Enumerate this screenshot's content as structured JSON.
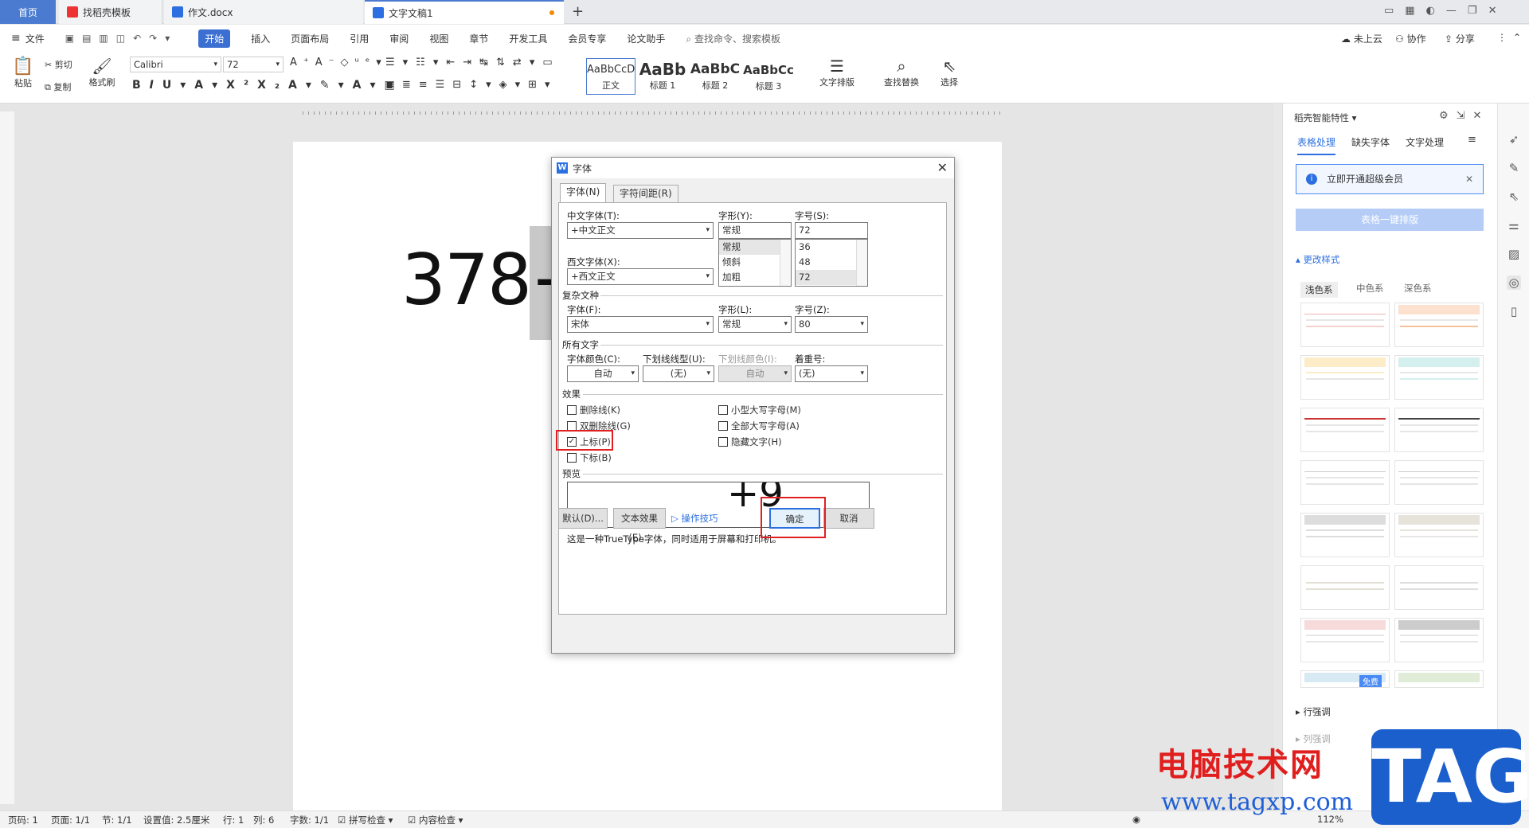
{
  "tabs": {
    "home": "首页",
    "template": "找稻壳模板",
    "doc1": "作文.docx",
    "doc2": "文字文稿1",
    "new_tab": "+"
  },
  "menu": {
    "file": "文件",
    "items": [
      "开始",
      "插入",
      "页面布局",
      "引用",
      "审阅",
      "视图",
      "章节",
      "开发工具",
      "会员专享",
      "论文助手"
    ],
    "search": "查找命令、搜索模板",
    "cloud": "未上云",
    "collab": "协作",
    "share": "分享"
  },
  "ribbon": {
    "paste": "粘贴",
    "cut": "剪切",
    "copy": "复制",
    "format_painter": "格式刷",
    "font_name": "Calibri",
    "font_size": "72",
    "styles": [
      {
        "preview": "AaBbCcD",
        "label": "正文"
      },
      {
        "preview": "AaBb",
        "label": "标题 1"
      },
      {
        "preview": "AaBbC",
        "label": "标题 2"
      },
      {
        "preview": "AaBbCc",
        "label": "标题 3"
      }
    ],
    "text_layout": "文字排版",
    "find_replace": "查找替换",
    "select": "选择"
  },
  "document": {
    "text": "378+"
  },
  "dialog": {
    "title": "字体",
    "tab_font": "字体(N)",
    "tab_spacing": "字符间距(R)",
    "cn_font_label": "中文字体(T):",
    "cn_font_value": "+中文正文",
    "style_label": "字形(Y):",
    "style_value": "常规",
    "size_label": "字号(S):",
    "size_value": "72",
    "style_list": [
      "常规",
      "倾斜",
      "加粗"
    ],
    "size_list": [
      "36",
      "48",
      "72"
    ],
    "west_font_label": "西文字体(X):",
    "west_font_value": "+西文正文",
    "complex_group": "复杂文种",
    "complex_font_label": "字体(F):",
    "complex_font_value": "宋体",
    "complex_style_label": "字形(L):",
    "complex_style_value": "常规",
    "complex_size_label": "字号(Z):",
    "complex_size_value": "80",
    "all_group": "所有文字",
    "color_label": "字体颜色(C):",
    "color_value": "自动",
    "underline_label": "下划线线型(U):",
    "underline_value": "(无)",
    "underline_color_label": "下划线颜色(I):",
    "underline_color_value": "自动",
    "emphasis_label": "着重号:",
    "emphasis_value": "(无)",
    "effects_group": "效果",
    "effects": {
      "strike": "删除线(K)",
      "double_strike": "双删除线(G)",
      "superscript": "上标(P)",
      "subscript": "下标(B)",
      "small_caps": "小型大写字母(M)",
      "all_caps": "全部大写字母(A)",
      "hidden": "隐藏文字(H)"
    },
    "superscript_checked": "✓",
    "preview_group": "预览",
    "preview_text": "+9",
    "note": "这是一种TrueType字体，同时适用于屏幕和打印机。",
    "btn_default": "默认(D)...",
    "btn_text_effect": "文本效果(E)...",
    "tips": "操作技巧",
    "btn_ok": "确定",
    "btn_cancel": "取消"
  },
  "right_panel": {
    "title": "稻壳智能特性",
    "tabs": [
      "表格处理",
      "缺失字体",
      "文字处理"
    ],
    "vip": "立即开通超级会员",
    "one_click": "表格一键排版",
    "change_style": "更改样式",
    "style_tabs": [
      "浅色系",
      "中色系",
      "深色系"
    ],
    "free": "免费",
    "row_adjust": "行强调",
    "col_adjust": "列强调"
  },
  "status": {
    "page_num": "页码: 1",
    "pages": "页面: 1/1",
    "section": "节: 1/1",
    "setting": "设置值: 2.5厘米",
    "row": "行: 1",
    "col": "列: 6",
    "words": "字数: 1/1",
    "spell": "拼写检查",
    "content_check": "内容检查",
    "zoom": "112%"
  },
  "watermark": {
    "cn": "电脑技术网",
    "url": "www.tagxp.com",
    "tag": "TAG"
  },
  "colors": {
    "accent": "#3b6fd1",
    "highlight_box": "#e02020"
  }
}
